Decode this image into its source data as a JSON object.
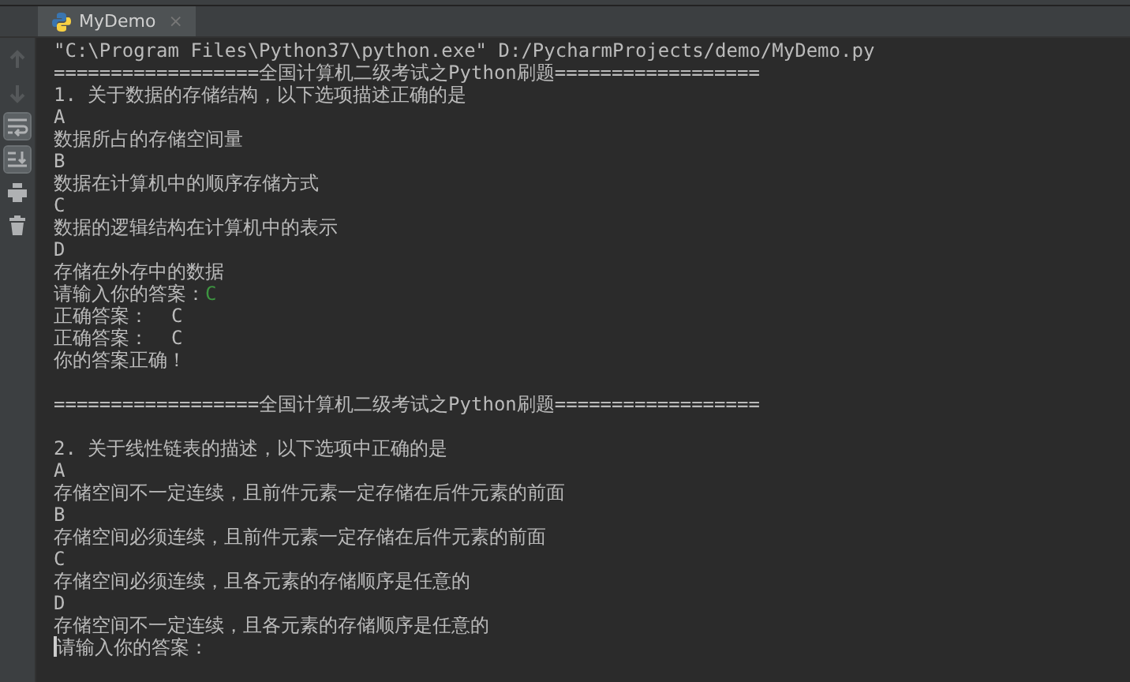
{
  "tab": {
    "title": "MyDemo",
    "selected": true,
    "close": "×"
  },
  "toolbar": [
    {
      "kind": "up",
      "disabled": true
    },
    {
      "kind": "down",
      "disabled": true
    },
    {
      "kind": "wrap",
      "selected": true
    },
    {
      "kind": "scroll-end",
      "selected": true
    },
    {
      "kind": "print",
      "disabled": false
    },
    {
      "kind": "trash",
      "disabled": false
    }
  ],
  "console_lines": [
    {
      "text": "\"C:\\Program Files\\Python37\\python.exe\" D:/PycharmProjects/demo/MyDemo.py"
    },
    {
      "text": "==================全国计算机二级考试之Python刷题=================="
    },
    {
      "text": "1. 关于数据的存储结构，以下选项描述正确的是"
    },
    {
      "text": "A"
    },
    {
      "text": "数据所占的存储空间量"
    },
    {
      "text": "B"
    },
    {
      "text": "数据在计算机中的顺序存储方式"
    },
    {
      "text": "C"
    },
    {
      "text": "数据的逻辑结构在计算机中的表示"
    },
    {
      "text": "D"
    },
    {
      "text": "存储在外存中的数据"
    },
    {
      "text": "请输入你的答案：",
      "input": "C"
    },
    {
      "text": "正确答案：  C"
    },
    {
      "text": "正确答案：  C"
    },
    {
      "text": "你的答案正确！"
    },
    {
      "kind": "blank"
    },
    {
      "text": "==================全国计算机二级考试之Python刷题=================="
    },
    {
      "kind": "blank"
    },
    {
      "text": "2. 关于线性链表的描述，以下选项中正确的是"
    },
    {
      "text": "A"
    },
    {
      "text": "存储空间不一定连续，且前件元素一定存储在后件元素的前面"
    },
    {
      "text": "B"
    },
    {
      "text": "存储空间必须连续，且前件元素一定存储在后件元素的前面"
    },
    {
      "text": "C"
    },
    {
      "text": "存储空间必须连续，且各元素的存储顺序是任意的"
    },
    {
      "text": "D"
    },
    {
      "text": "存储空间不一定连续，且各元素的存储顺序是任意的"
    },
    {
      "text": "请输入你的答案：",
      "caret": true
    }
  ]
}
